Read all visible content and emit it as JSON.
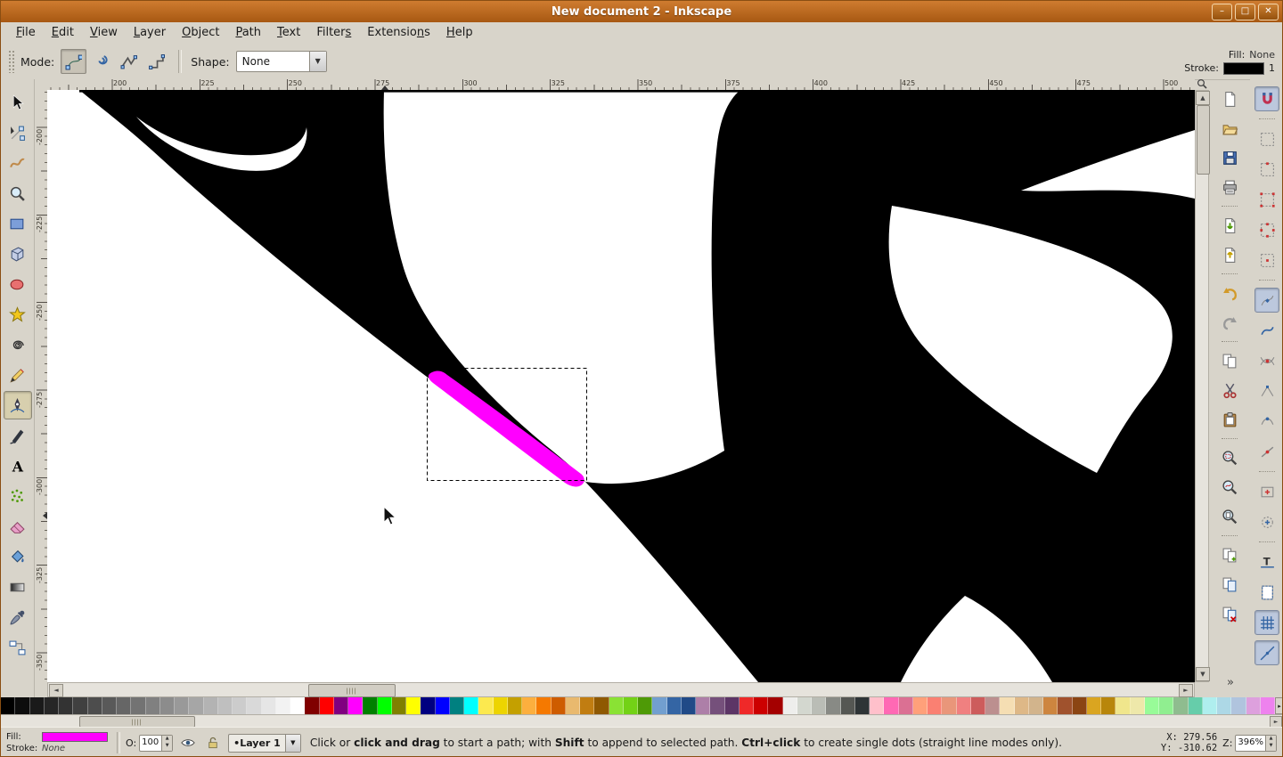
{
  "window": {
    "title": "New document 2 - Inkscape",
    "buttons": [
      {
        "name": "minimize",
        "glyph": "–"
      },
      {
        "name": "maximize",
        "glyph": "□"
      },
      {
        "name": "close",
        "glyph": "✕"
      }
    ]
  },
  "menu": {
    "items": [
      {
        "label": "File",
        "m": 0
      },
      {
        "label": "Edit",
        "m": 0
      },
      {
        "label": "View",
        "m": 0
      },
      {
        "label": "Layer",
        "m": 0
      },
      {
        "label": "Object",
        "m": 0
      },
      {
        "label": "Path",
        "m": 0
      },
      {
        "label": "Text",
        "m": 0
      },
      {
        "label": "Filters",
        "m": 6
      },
      {
        "label": "Extensions",
        "m": 8
      },
      {
        "label": "Help",
        "m": 0
      }
    ]
  },
  "tool_options": {
    "mode_label": "Mode:",
    "modes": [
      {
        "name": "mode-regular-bezier",
        "active": true
      },
      {
        "name": "mode-spiro",
        "active": false
      },
      {
        "name": "mode-zigzag",
        "active": false
      },
      {
        "name": "mode-paraxial",
        "active": false
      }
    ],
    "shape_label": "Shape:",
    "shape_value": "None"
  },
  "fill_stroke_indicator": {
    "fill_label": "Fill:",
    "fill_value": "None",
    "stroke_label": "Stroke:",
    "stroke_swatch": "#000000",
    "stroke_width": "1"
  },
  "toolbox": {
    "tools": [
      {
        "name": "selector"
      },
      {
        "name": "node-editor"
      },
      {
        "name": "tweak"
      },
      {
        "name": "zoom"
      },
      {
        "name": "rectangle"
      },
      {
        "name": "box-3d"
      },
      {
        "name": "ellipse"
      },
      {
        "name": "star"
      },
      {
        "name": "spiral"
      },
      {
        "name": "pencil"
      },
      {
        "name": "pen",
        "active": true
      },
      {
        "name": "calligraphy"
      },
      {
        "name": "text"
      },
      {
        "name": "spray"
      },
      {
        "name": "eraser"
      },
      {
        "name": "paint-bucket"
      },
      {
        "name": "gradient"
      },
      {
        "name": "dropper"
      },
      {
        "name": "connector"
      }
    ]
  },
  "commands": [
    "new-document",
    "open-document",
    "save-document",
    "print-document",
    "import-image",
    "export-image",
    "undo",
    "redo",
    "copy",
    "cut",
    "paste",
    "zoom-selection",
    "zoom-drawing",
    "zoom-page",
    "duplicate",
    "create-clone",
    "unlink-clone"
  ],
  "snap_controls": [
    {
      "name": "snap-enable",
      "active": true
    },
    {
      "name": "snap-bounding-box",
      "active": false
    },
    {
      "name": "snap-bbox-edges",
      "active": false
    },
    {
      "name": "snap-bbox-corners",
      "active": false
    },
    {
      "name": "snap-bbox-edge-midpoints",
      "active": false
    },
    {
      "name": "snap-bbox-centers",
      "active": false
    },
    {
      "name": "snap-nodes",
      "active": true
    },
    {
      "name": "snap-paths",
      "active": false
    },
    {
      "name": "snap-path-intersections",
      "active": false
    },
    {
      "name": "snap-cusp-nodes",
      "active": false
    },
    {
      "name": "snap-smooth-nodes",
      "active": false
    },
    {
      "name": "snap-line-midpoints",
      "active": false
    },
    {
      "name": "snap-object-centers",
      "active": false
    },
    {
      "name": "snap-rotation-centers",
      "active": false
    },
    {
      "name": "snap-text-baseline",
      "active": false
    },
    {
      "name": "snap-page-border",
      "active": false
    },
    {
      "name": "snap-grids",
      "active": true
    },
    {
      "name": "snap-guides",
      "active": true
    }
  ],
  "rulers": {
    "h_labels": [
      "200",
      "225",
      "250",
      "275",
      "300",
      "325",
      "350",
      "375",
      "400",
      "425",
      "450",
      "475",
      "500"
    ],
    "v_labels": [
      "-200",
      "-225",
      "-250",
      "-275",
      "-300",
      "-325",
      "-350"
    ]
  },
  "palette": {
    "colors": [
      "#000000",
      "#0d0d0d",
      "#1a1a1a",
      "#262626",
      "#333333",
      "#404040",
      "#4d4d4d",
      "#595959",
      "#666666",
      "#737373",
      "#808080",
      "#8c8c8c",
      "#999999",
      "#a6a6a6",
      "#b3b3b3",
      "#bfbfbf",
      "#cccccc",
      "#d9d9d9",
      "#e6e6e6",
      "#f2f2f2",
      "#ffffff",
      "#800000",
      "#ff0000",
      "#800080",
      "#ff00ff",
      "#008000",
      "#00ff00",
      "#808000",
      "#ffff00",
      "#000080",
      "#0000ff",
      "#008080",
      "#00ffff",
      "#fce94f",
      "#edd400",
      "#c4a000",
      "#fcaf3e",
      "#f57900",
      "#ce5c00",
      "#e9b96e",
      "#c17d11",
      "#8f5902",
      "#8ae234",
      "#73d216",
      "#4e9a06",
      "#729fcf",
      "#3465a4",
      "#204a87",
      "#ad7fa8",
      "#75507b",
      "#5c3566",
      "#ef2929",
      "#cc0000",
      "#a40000",
      "#eeeeec",
      "#d3d7cf",
      "#babdb6",
      "#888a85",
      "#555753",
      "#2e3436",
      "#ffc0cb",
      "#ff69b4",
      "#db7093",
      "#ffa07a",
      "#fa8072",
      "#e9967a",
      "#f08080",
      "#cd5c5c",
      "#bc8f8f",
      "#f5deb3",
      "#deb887",
      "#d2b48c",
      "#cd853f",
      "#a0522d",
      "#8b4513",
      "#daa520",
      "#b8860b",
      "#f0e68c",
      "#eee8aa",
      "#98fb98",
      "#90ee90",
      "#8fbc8f",
      "#66cdaa",
      "#afeeee",
      "#add8e6",
      "#b0c4de",
      "#dda0dd",
      "#ee82ee"
    ]
  },
  "status_bar": {
    "fill_label": "Fill:",
    "stroke_label": "Stroke:",
    "fill_swatch": "#ff00ff",
    "stroke_value": "None",
    "opacity_label": "O:",
    "opacity_value": "100",
    "layer_prefix": "•",
    "layer_name": "Layer 1",
    "message": [
      {
        "t": "Click",
        "b": false
      },
      {
        "t": " or ",
        "b": false
      },
      {
        "t": "click and drag",
        "b": true
      },
      {
        "t": " to start a path; with ",
        "b": false
      },
      {
        "t": "Shift",
        "b": true
      },
      {
        "t": " to append to selected path. ",
        "b": false
      },
      {
        "t": "Ctrl+click",
        "b": true
      },
      {
        "t": " to create single dots (straight line modes only).",
        "b": false
      }
    ],
    "x_label": "X:",
    "x_value": "279.56",
    "y_label": "Y:",
    "y_value": "-310.62",
    "z_label": "Z:",
    "zoom_value": "396%"
  }
}
